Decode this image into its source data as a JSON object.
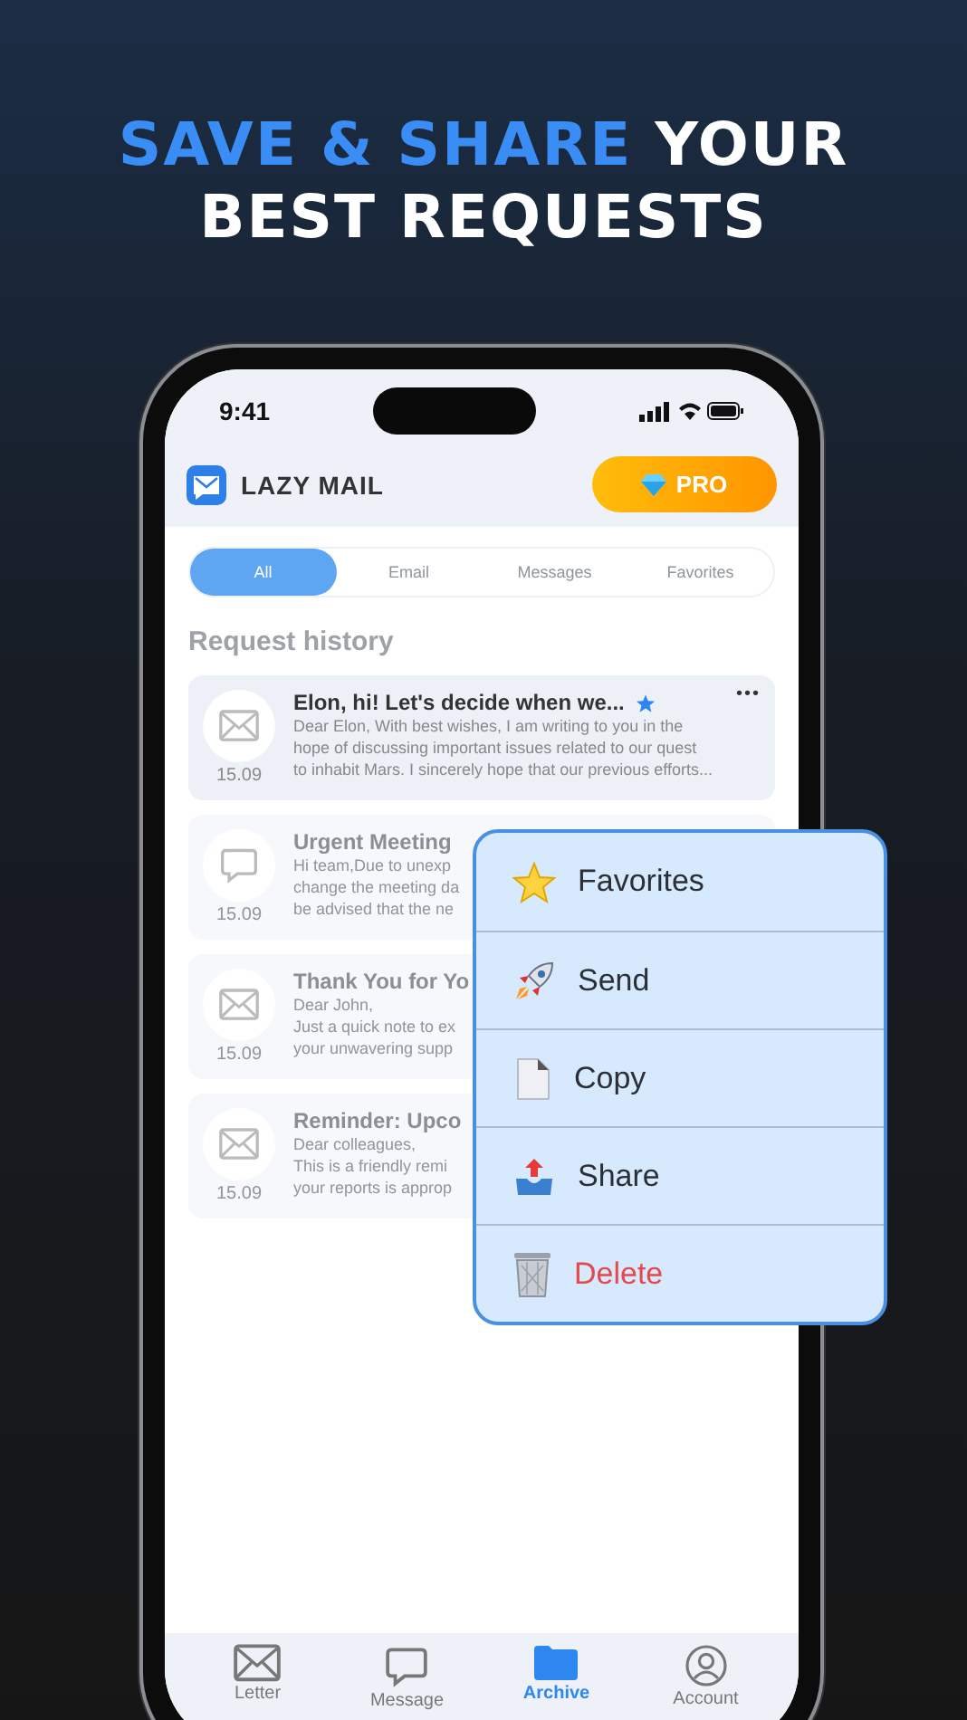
{
  "headline": {
    "accent": "SAVE & SHARE",
    "rest": "YOUR",
    "line2": "BEST REQUESTS"
  },
  "status_bar": {
    "time": "9:41"
  },
  "app_header": {
    "title": "LAZY MAIL",
    "pro_button": "PRO"
  },
  "filter_tabs": [
    {
      "label": "All",
      "selected": true
    },
    {
      "label": "Email",
      "selected": false
    },
    {
      "label": "Messages",
      "selected": false
    },
    {
      "label": "Favorites",
      "selected": false
    }
  ],
  "section_title": "Request history",
  "requests": [
    {
      "kind": "letter",
      "title": "Elon, hi! Let's decide when we...",
      "favorite": true,
      "date": "15.09",
      "blurred": false,
      "preview": [
        "Dear Elon, With best wishes, I am writing to you in the",
        "hope of discussing important issues related to our quest",
        "to inhabit Mars. I sincerely hope that our previous efforts..."
      ],
      "menu_button": "•••"
    },
    {
      "kind": "message",
      "title": "Urgent Meeting",
      "favorite": false,
      "date": "15.09",
      "blurred": true,
      "preview": [
        "Hi team,Due to unexp",
        "change the meeting da",
        "be advised that the ne"
      ]
    },
    {
      "kind": "letter",
      "title": "Thank You for Yo",
      "favorite": false,
      "date": "15.09",
      "blurred": true,
      "preview": [
        "Dear John,",
        "Just a quick note to ex",
        "your unwavering supp"
      ]
    },
    {
      "kind": "letter",
      "title": "Reminder: Upco",
      "favorite": false,
      "date": "15.09",
      "blurred": true,
      "preview": [
        "Dear colleagues,",
        "This is a friendly remi",
        "your reports is approp"
      ]
    }
  ],
  "context_menu": [
    {
      "kind": "star",
      "label": "Favorites",
      "destructive": false
    },
    {
      "kind": "rocket",
      "label": "Send",
      "destructive": false
    },
    {
      "kind": "copy",
      "label": "Copy",
      "destructive": false
    },
    {
      "kind": "share",
      "label": "Share",
      "destructive": false
    },
    {
      "kind": "trash",
      "label": "Delete",
      "destructive": true
    }
  ],
  "tab_bar": [
    {
      "kind": "letter",
      "label": "Letter",
      "selected": false
    },
    {
      "kind": "message",
      "label": "Message",
      "selected": false
    },
    {
      "kind": "archive",
      "label": "Archive",
      "selected": true
    },
    {
      "kind": "account",
      "label": "Account",
      "selected": false
    }
  ]
}
